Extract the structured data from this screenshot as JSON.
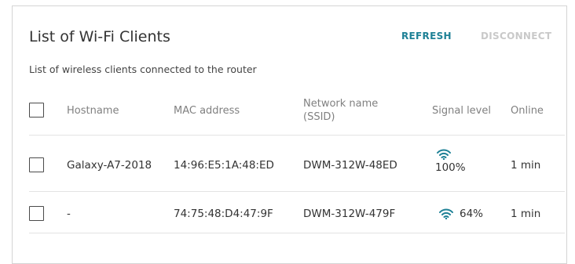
{
  "panel": {
    "title": "List of Wi-Fi Clients",
    "subtitle": "List of wireless clients connected to the router",
    "actions": {
      "refresh": "REFRESH",
      "disconnect": "DISCONNECT"
    },
    "accent_color": "#1e8196",
    "disabled_color": "#c9c9c9"
  },
  "table": {
    "headers": {
      "hostname": "Hostname",
      "mac": "MAC address",
      "ssid_line1": "Network name",
      "ssid_line2": "(SSID)",
      "signal": "Signal level",
      "online": "Online"
    },
    "rows": [
      {
        "hostname": "Galaxy-A7-2018",
        "mac": "14:96:E5:1A:48:ED",
        "ssid": "DWM-312W-48ED",
        "signal": "100%",
        "signal_icon": "wifi-icon",
        "online": "1 min",
        "checked": false
      },
      {
        "hostname": "-",
        "mac": "74:75:48:D4:47:9F",
        "ssid": "DWM-312W-479F",
        "signal": "64%",
        "signal_icon": "wifi-icon",
        "online": "1 min",
        "checked": false
      }
    ]
  }
}
